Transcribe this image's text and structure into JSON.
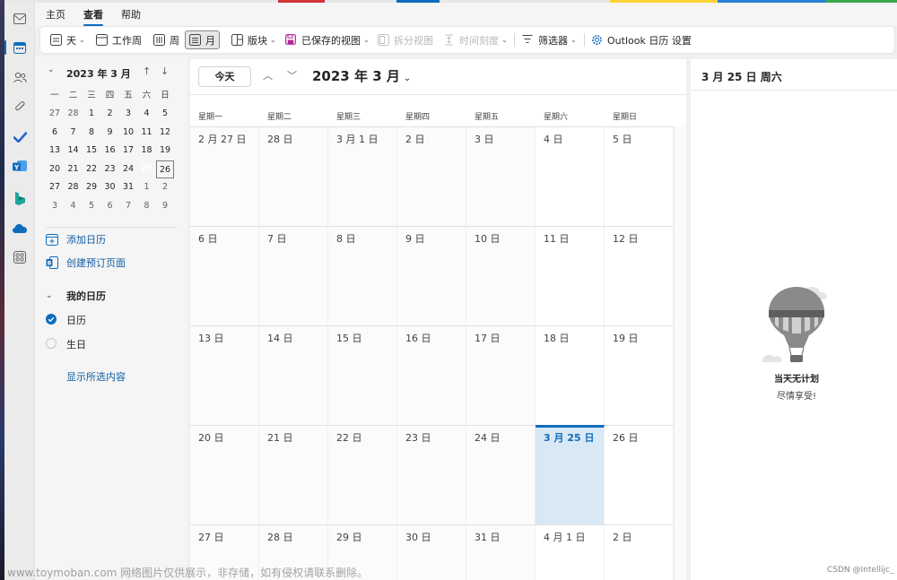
{
  "colors": {
    "accent": "#0f6cbd",
    "strip": [
      "#d13438",
      "#0f6cbd",
      "#ffb900",
      "#107c10",
      "#0078d4",
      "#e3e3e3"
    ]
  },
  "topbar": {
    "tabs": [
      {
        "label": "主页",
        "active": false
      },
      {
        "label": "查看",
        "active": true
      },
      {
        "label": "帮助",
        "active": false
      }
    ]
  },
  "ribbon": {
    "day": "天",
    "work_week": "工作周",
    "week": "周",
    "month": "月",
    "board": "版块",
    "saved_views": "已保存的视图",
    "split_view": "拆分视图",
    "time_scale": "时间刻度",
    "filter": "筛选器",
    "settings": "Outlook 日历 设置"
  },
  "mini_calendar": {
    "title": "2023 年 3 月",
    "weekdays": [
      "一",
      "二",
      "三",
      "四",
      "五",
      "六",
      "日"
    ],
    "weeks": [
      [
        "27",
        "28",
        "1",
        "2",
        "3",
        "4",
        "5"
      ],
      [
        "6",
        "7",
        "8",
        "9",
        "10",
        "11",
        "12"
      ],
      [
        "13",
        "14",
        "15",
        "16",
        "17",
        "18",
        "19"
      ],
      [
        "20",
        "21",
        "22",
        "23",
        "24",
        "25",
        "26"
      ],
      [
        "27",
        "28",
        "29",
        "30",
        "31",
        "1",
        "2"
      ],
      [
        "3",
        "4",
        "5",
        "6",
        "7",
        "8",
        "9"
      ]
    ],
    "today": "25",
    "selected_next": "26"
  },
  "sidebar": {
    "add_calendar": "添加日历",
    "create_booking": "创建预订页面",
    "my_calendars": "我的日历",
    "calendar_item": "日历",
    "birthday_item": "生日",
    "show_all": "显示所选内容"
  },
  "main": {
    "today_button": "今天",
    "month_title": "2023 年 3 月",
    "weekdays": [
      "星期一",
      "星期二",
      "星期三",
      "星期四",
      "星期五",
      "星期六",
      "星期日"
    ],
    "weeks": [
      [
        "2 月 27 日",
        "28 日",
        "3 月 1 日",
        "2 日",
        "3 日",
        "4 日",
        "5 日"
      ],
      [
        "6 日",
        "7 日",
        "8 日",
        "9 日",
        "10 日",
        "11 日",
        "12 日"
      ],
      [
        "13 日",
        "14 日",
        "15 日",
        "16 日",
        "17 日",
        "18 日",
        "19 日"
      ],
      [
        "20 日",
        "21 日",
        "22 日",
        "23 日",
        "24 日",
        "3 月 25 日",
        "26 日"
      ],
      [
        "27 日",
        "28 日",
        "29 日",
        "30 日",
        "31 日",
        "4 月 1 日",
        "2 日"
      ]
    ],
    "selected_day": "3 月 25 日"
  },
  "right_panel": {
    "date_title": "3 月 25 日 周六",
    "empty_title": "当天无计划",
    "empty_subtitle": "尽情享受!"
  },
  "watermark": "www.toymoban.com 网络图片仅供展示，非存储，如有侵权请联系删除。",
  "csdn_mark": "CSDN @Intellijc_"
}
